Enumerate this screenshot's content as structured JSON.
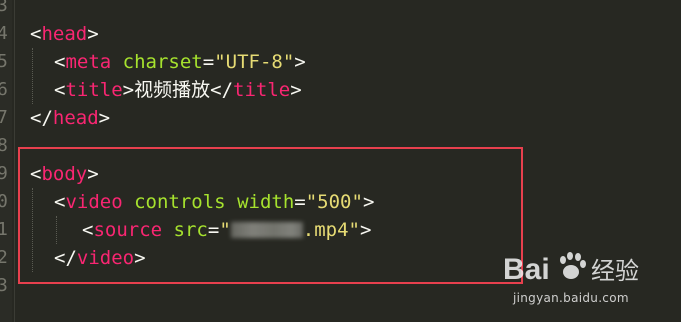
{
  "gutter": {
    "line_numbers": [
      "3",
      "4",
      "5",
      "6",
      "7",
      "8",
      "9",
      "0",
      "1",
      "2",
      "3"
    ]
  },
  "code": {
    "line4": {
      "tag": "head"
    },
    "line5": {
      "tag": "meta",
      "attr": "charset",
      "value": "\"UTF-8\""
    },
    "line6": {
      "open_tag": "title",
      "text": "视频播放",
      "close_tag": "title"
    },
    "line7": {
      "tag": "head"
    },
    "line9": {
      "tag": "body"
    },
    "line10": {
      "tag": "video",
      "attr1": "controls",
      "attr2": "width",
      "value": "\"500\""
    },
    "line11": {
      "tag": "source",
      "attr": "src",
      "value_start": "\"",
      "value_end": ".mp4\""
    },
    "line12": {
      "tag": "video"
    }
  },
  "watermark": {
    "brand": "Bai",
    "brand_suffix": "经验",
    "url": "jingyan.baidu.com"
  },
  "colors": {
    "background": "#272822",
    "tag": "#f92672",
    "attribute": "#a6e22e",
    "string": "#e6db74",
    "plain": "#f8f8f2",
    "highlight_box": "#e8404e"
  }
}
